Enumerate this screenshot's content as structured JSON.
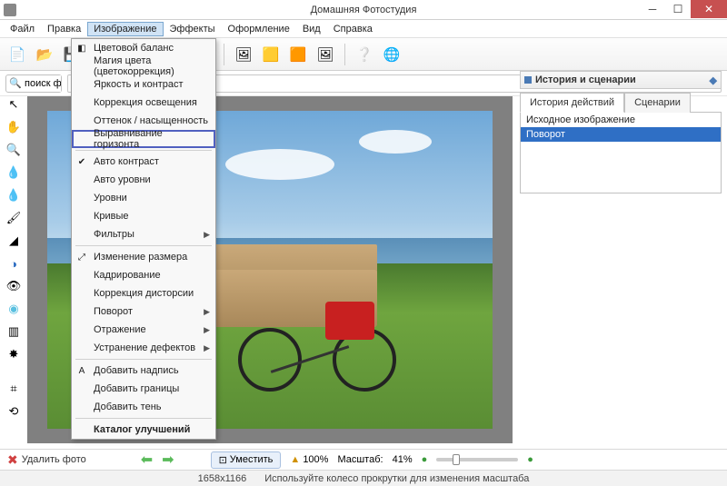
{
  "titlebar": {
    "title": "Домашняя Фотостудия"
  },
  "menubar": [
    "Файл",
    "Правка",
    "Изображение",
    "Эффекты",
    "Оформление",
    "Вид",
    "Справка"
  ],
  "menubar_active_index": 2,
  "search": {
    "placeholder": "поиск фу"
  },
  "dropdown": {
    "items": [
      {
        "label": "Цветовой баланс",
        "icon": "◧"
      },
      {
        "label": "Магия цвета (цветокоррекция)"
      },
      {
        "label": "Яркость и контраст"
      },
      {
        "label": "Коррекция освещения"
      },
      {
        "label": "Оттенок / насыщенность"
      },
      {
        "label": "Выравнивание горизонта",
        "highlight": true
      },
      {
        "sep": true
      },
      {
        "label": "Авто контраст",
        "icon": "✔"
      },
      {
        "label": "Авто уровни"
      },
      {
        "label": "Уровни"
      },
      {
        "label": "Кривые"
      },
      {
        "label": "Фильтры",
        "submenu": true
      },
      {
        "sep": true
      },
      {
        "label": "Изменение размера",
        "icon": "⤢"
      },
      {
        "label": "Кадрирование"
      },
      {
        "label": "Коррекция дисторсии"
      },
      {
        "label": "Поворот",
        "submenu": true
      },
      {
        "label": "Отражение",
        "submenu": true
      },
      {
        "label": "Устранение дефектов",
        "submenu": true
      },
      {
        "sep": true
      },
      {
        "label": "Добавить надпись",
        "icon": "A"
      },
      {
        "label": "Добавить границы"
      },
      {
        "label": "Добавить тень"
      },
      {
        "sep": true
      },
      {
        "label": "Каталог улучшений",
        "bold": true
      }
    ]
  },
  "rightpanel": {
    "title": "История и сценарии",
    "tabs": [
      "История действий",
      "Сценарии"
    ],
    "active_tab": 0,
    "history": [
      "Исходное изображение",
      "Поворот"
    ],
    "selected": 1
  },
  "statusbar": {
    "delete_label": "Удалить фото",
    "fit_label": "Уместить",
    "zoom_pct": "100%",
    "scale_label": "Масштаб:",
    "scale_value": "41%",
    "dimensions": "1658x1166",
    "hint": "Используйте колесо прокрутки для изменения масштаба"
  },
  "toolbar_icons": [
    "new",
    "open",
    "save",
    "|",
    "undo",
    "redo",
    "|",
    "text",
    "palette",
    "|",
    "frame",
    "frame2",
    "frame3",
    "album",
    "|",
    "help",
    "web"
  ],
  "left_tools": [
    "pointer",
    "hand",
    "zoom",
    "drop",
    "drop2",
    "brush",
    "eraser",
    "circle",
    "eye",
    "blur",
    "gradient",
    "stamp",
    "",
    "crop",
    "rotate"
  ]
}
